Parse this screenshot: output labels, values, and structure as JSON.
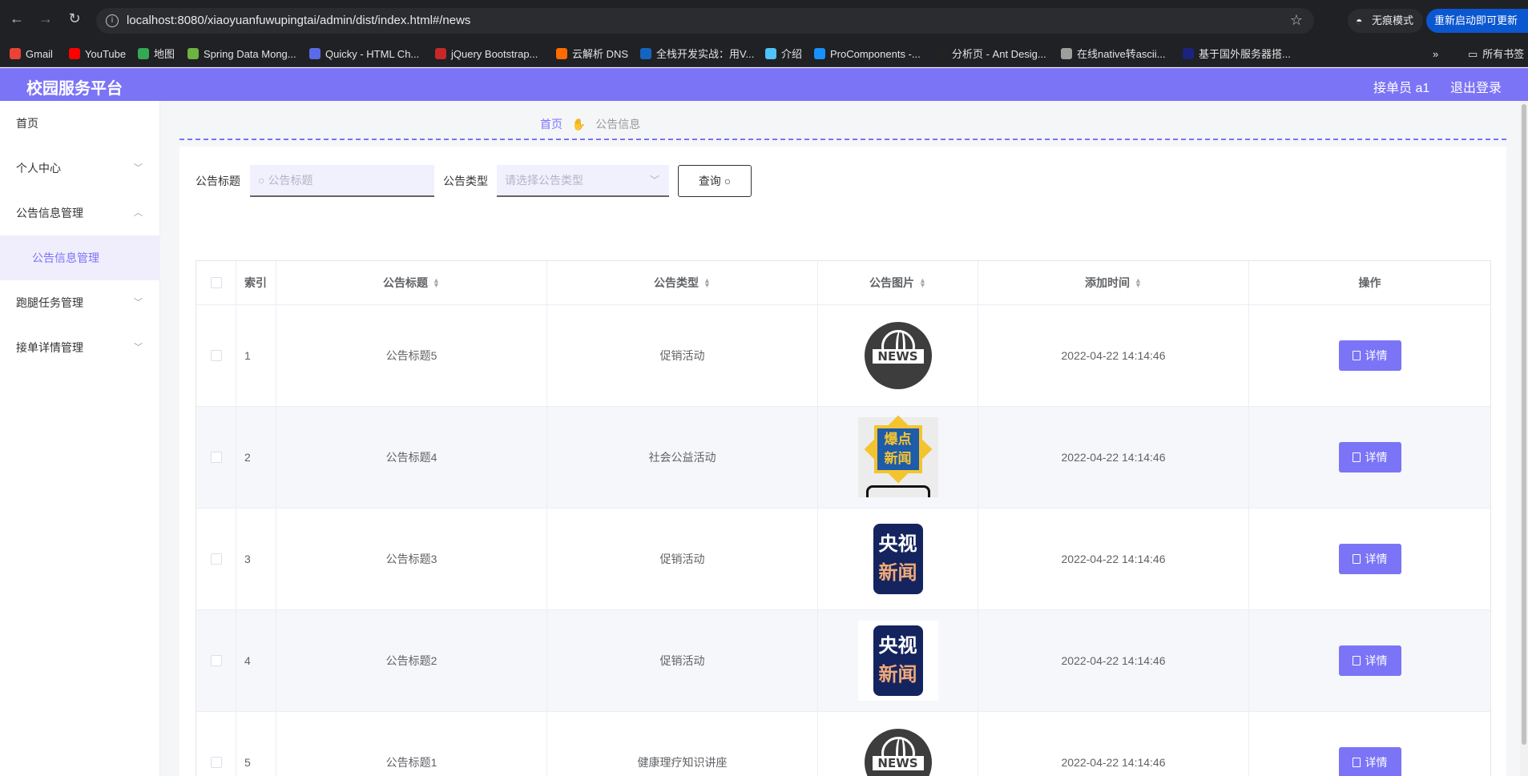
{
  "browser": {
    "url": "localhost:8080/xiaoyuanfuwupingtai/admin/dist/index.html#/news",
    "incognito_label": "无痕模式",
    "update_label": "重新启动即可更新",
    "bookmarks": [
      "Gmail",
      "YouTube",
      "地图",
      "Spring Data Mong...",
      "Quicky - HTML Ch...",
      "jQuery Bootstrap...",
      "云解析 DNS",
      "全栈开发实战：用V...",
      "介绍",
      "ProComponents -...",
      "分析页 - Ant Desig...",
      "在线native转ascii...",
      "基于国外服务器搭..."
    ],
    "all_bookmarks_label": "所有书签",
    "bookmark_colors": [
      "#ea4335",
      "#ff0000",
      "#34a853",
      "#6db33f",
      "#5b6be8",
      "#c62828",
      "#ff6a00",
      "#1565c0",
      "#4fc3f7",
      "#1890ff",
      "#222222",
      "#9e9e9e",
      "#1a237e"
    ]
  },
  "header": {
    "title": "校园服务平台",
    "user": "接单员 a1",
    "logout": "退出登录"
  },
  "sidebar": {
    "items": [
      {
        "label": "首页"
      },
      {
        "label": "个人中心"
      },
      {
        "label": "公告信息管理"
      },
      {
        "label": "公告信息管理"
      },
      {
        "label": "跑腿任务管理"
      },
      {
        "label": "接单详情管理"
      }
    ]
  },
  "breadcrumb": {
    "home": "首页",
    "current": "公告信息"
  },
  "filters": {
    "title_label": "公告标题",
    "title_placeholder": "公告标题",
    "type_label": "公告类型",
    "type_placeholder": "请选择公告类型",
    "query_label": "查询"
  },
  "table": {
    "columns": [
      "索引",
      "公告标题",
      "公告类型",
      "公告图片",
      "添加时间",
      "操作"
    ],
    "detail_label": "详情",
    "rows": [
      {
        "index": "1",
        "title": "公告标题5",
        "type": "促销活动",
        "image": "news-globe",
        "time": "2022-04-22 14:14:46"
      },
      {
        "index": "2",
        "title": "公告标题4",
        "type": "社会公益活动",
        "image": "baodian-news",
        "time": "2022-04-22 14:14:46"
      },
      {
        "index": "3",
        "title": "公告标题3",
        "type": "促销活动",
        "image": "cctv-news",
        "time": "2022-04-22 14:14:46"
      },
      {
        "index": "4",
        "title": "公告标题2",
        "type": "促销活动",
        "image": "cctv-news",
        "time": "2022-04-22 14:14:46"
      },
      {
        "index": "5",
        "title": "公告标题1",
        "type": "健康理疗知识讲座",
        "image": "news-globe",
        "time": "2022-04-22 14:14:46"
      }
    ]
  },
  "images": {
    "news_text": "NEWS",
    "baodian_text_1": "爆点",
    "baodian_text_2": "新闻",
    "cctv_text_1": "央视",
    "cctv_text_2": "新闻"
  },
  "colors": {
    "accent": "#7b74f7",
    "browser_bg": "#202124"
  }
}
